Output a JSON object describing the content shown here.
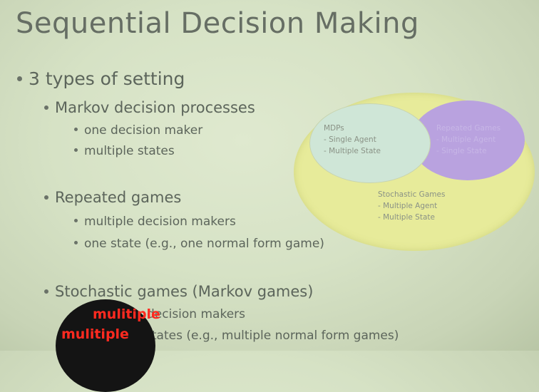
{
  "slide": {
    "title": "Sequential Decision Making",
    "bullets": [
      {
        "level": 1,
        "text": "3 types of setting"
      },
      {
        "level": 2,
        "text": "Markov decision processes"
      },
      {
        "level": 3,
        "text": "one decision maker"
      },
      {
        "level": 3,
        "text": "multiple states"
      },
      {
        "level": 2,
        "text": "Repeated games"
      },
      {
        "level": 3,
        "text": "multiple decision makers"
      },
      {
        "level": 3,
        "text": "one state (e.g., one normal form game)"
      },
      {
        "level": 2,
        "text": "Stochastic games (Markov games)"
      },
      {
        "level": 3,
        "text": "decision makers"
      },
      {
        "level": 3,
        "text": "states (e.g., multiple normal form games)"
      }
    ]
  },
  "venn": {
    "mdps": {
      "title": "MDPs",
      "line1": "- Single Agent",
      "line2": "- Multiple State"
    },
    "repeated": {
      "title": "Repeated Games",
      "line1": "- Multiple Agent",
      "line2": "- Single State"
    },
    "stochastic": {
      "title": "Stochastic Games",
      "line1": "- Multiple Agent",
      "line2": "- Multiple State"
    },
    "colors": {
      "outer": "#e7eb9a",
      "mdps": "#cfe6d7",
      "repeated": "#b9a2df"
    }
  },
  "captions": {
    "top": "mulitiple",
    "bottom": "mulitiple"
  }
}
